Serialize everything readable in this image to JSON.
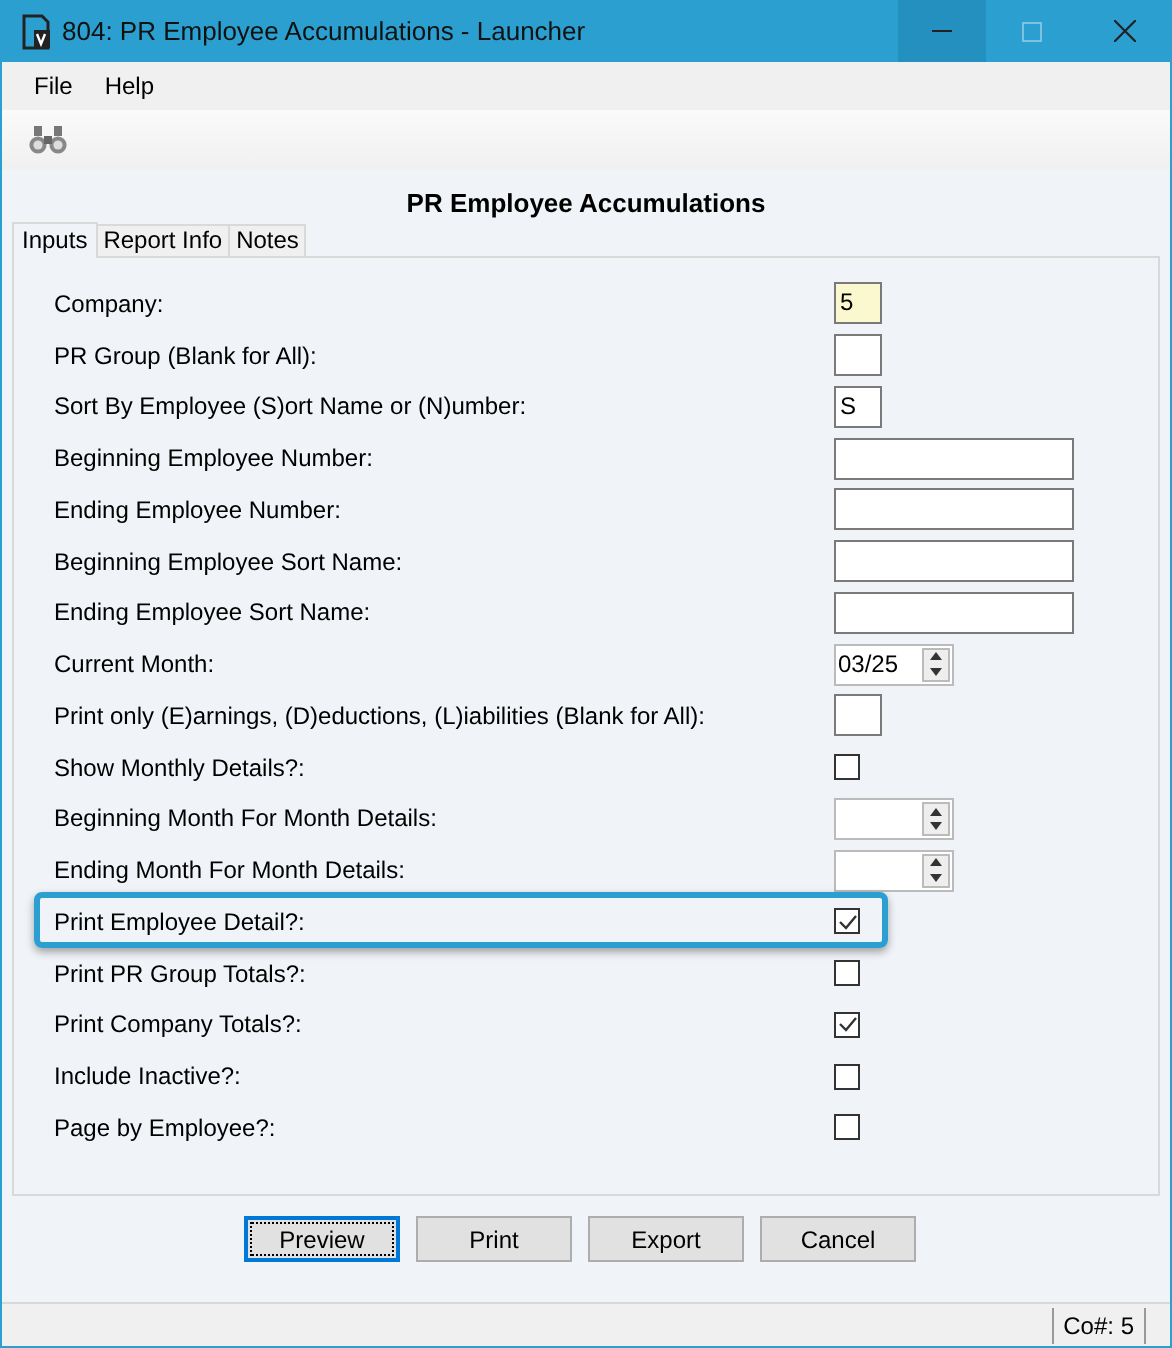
{
  "window": {
    "title": "804: PR Employee Accumulations - Launcher"
  },
  "menu": [
    "File",
    "Help"
  ],
  "heading": "PR Employee Accumulations",
  "tabs": [
    {
      "label": "Inputs",
      "selected": true
    },
    {
      "label": "Report Info",
      "selected": false
    },
    {
      "label": "Notes",
      "selected": false
    }
  ],
  "fields": [
    {
      "kind": "text",
      "label": "Company:",
      "value": "5",
      "focused": true,
      "highlighted": false
    },
    {
      "kind": "text",
      "label": "PR Group (Blank for All):",
      "focused": false,
      "highlighted": false
    },
    {
      "kind": "text",
      "label": "Sort By Employee (S)ort Name or (N)umber:",
      "value": "S",
      "focused": false,
      "highlighted": false
    },
    {
      "kind": "wide_text",
      "label": "Beginning Employee Number:",
      "focused": false,
      "highlighted": false
    },
    {
      "kind": "wide_text",
      "label": "Ending Employee Number:",
      "focused": false,
      "highlighted": false
    },
    {
      "kind": "wide_text",
      "label": "Beginning Employee Sort Name:",
      "focused": false,
      "highlighted": false
    },
    {
      "kind": "wide_text",
      "label": "Ending Employee Sort Name:",
      "focused": false,
      "highlighted": false
    },
    {
      "kind": "spinner",
      "label": "Current Month:",
      "value": "03/25",
      "highlighted": false
    },
    {
      "kind": "text",
      "label": "Print only (E)arnings, (D)eductions, (L)iabilities (Blank for All):",
      "focused": false,
      "highlighted": false
    },
    {
      "kind": "checkbox",
      "label": "Show Monthly Details?:",
      "checked": false,
      "highlighted": false
    },
    {
      "kind": "spinner",
      "label": "Beginning Month For Month Details:",
      "highlighted": false
    },
    {
      "kind": "spinner",
      "label": "Ending Month For Month Details:",
      "highlighted": false
    },
    {
      "kind": "checkbox",
      "label": "Print Employee Detail?:",
      "checked": true,
      "highlighted": true
    },
    {
      "kind": "checkbox",
      "label": "Print PR Group Totals?:",
      "checked": false,
      "highlighted": false
    },
    {
      "kind": "checkbox",
      "label": "Print Company Totals?:",
      "checked": true,
      "highlighted": false
    },
    {
      "kind": "checkbox",
      "label": "Include Inactive?:",
      "checked": false,
      "highlighted": false
    },
    {
      "kind": "checkbox",
      "label": "Page by Employee?:",
      "checked": false,
      "highlighted": false
    }
  ],
  "buttons": [
    {
      "label": "Preview",
      "default": true
    },
    {
      "label": "Print",
      "default": false
    },
    {
      "label": "Export",
      "default": false
    },
    {
      "label": "Cancel",
      "default": false
    }
  ],
  "status_bar": {
    "company": "Co#: 5"
  }
}
